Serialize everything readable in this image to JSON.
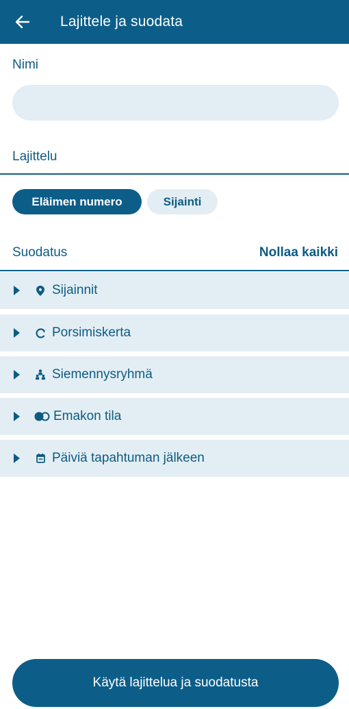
{
  "appbar": {
    "title": "Lajittele ja suodata",
    "back_icon": "arrow-left-icon"
  },
  "name_field": {
    "label": "Nimi",
    "value": "",
    "placeholder": ""
  },
  "sorting": {
    "label": "Lajittelu",
    "options": [
      {
        "label": "Eläimen numero",
        "selected": true
      },
      {
        "label": "Sijainti",
        "selected": false
      }
    ]
  },
  "filters": {
    "label": "Suodatus",
    "reset_label": "Nollaa kaikki",
    "items": [
      {
        "label": "Sijainnit",
        "icon": "location-pin-icon"
      },
      {
        "label": "Porsimiskerta",
        "icon": "cycle-icon"
      },
      {
        "label": "Siemennysryhmä",
        "icon": "group-icon"
      },
      {
        "label": "Emakon tila",
        "icon": "toggle-icon"
      },
      {
        "label": "Päiviä tapahtuman jälkeen",
        "icon": "calendar-icon"
      }
    ]
  },
  "apply_button": {
    "label": "Käytä lajittelua ja suodatusta"
  },
  "colors": {
    "primary": "#0c5e89",
    "light": "#e3eef4",
    "text": "#0d5b83"
  }
}
